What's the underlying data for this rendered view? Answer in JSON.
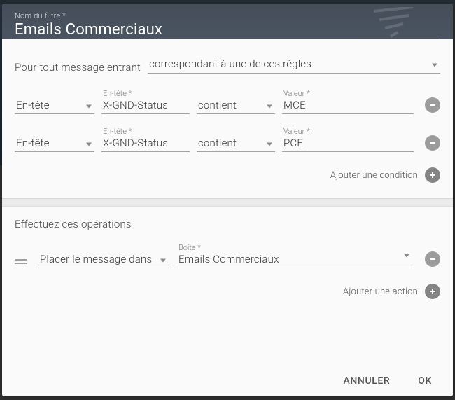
{
  "filter": {
    "name_label": "Nom du filtre *",
    "name_value": "Emails Commerciaux"
  },
  "match": {
    "intro_label": "Pour tout message entrant",
    "mode": "correspondant à une de ces règles"
  },
  "fields": {
    "header_label": "En-tête *",
    "value_label": "Valeur *",
    "mailbox_label": "Boîte *"
  },
  "conditions": [
    {
      "type": "En-tête",
      "header": "X-GND-Status",
      "operator": "contient",
      "value": "MCE"
    },
    {
      "type": "En-tête",
      "header": "X-GND-Status",
      "operator": "contient",
      "value": "PCE"
    }
  ],
  "add_condition_label": "Ajouter une condition",
  "operations": {
    "title": "Effectuez ces opérations",
    "items": [
      {
        "action": "Placer le message dans",
        "mailbox": "Emails Commerciaux"
      }
    ],
    "add_action_label": "Ajouter une action"
  },
  "buttons": {
    "cancel": "ANNULER",
    "ok": "OK"
  }
}
